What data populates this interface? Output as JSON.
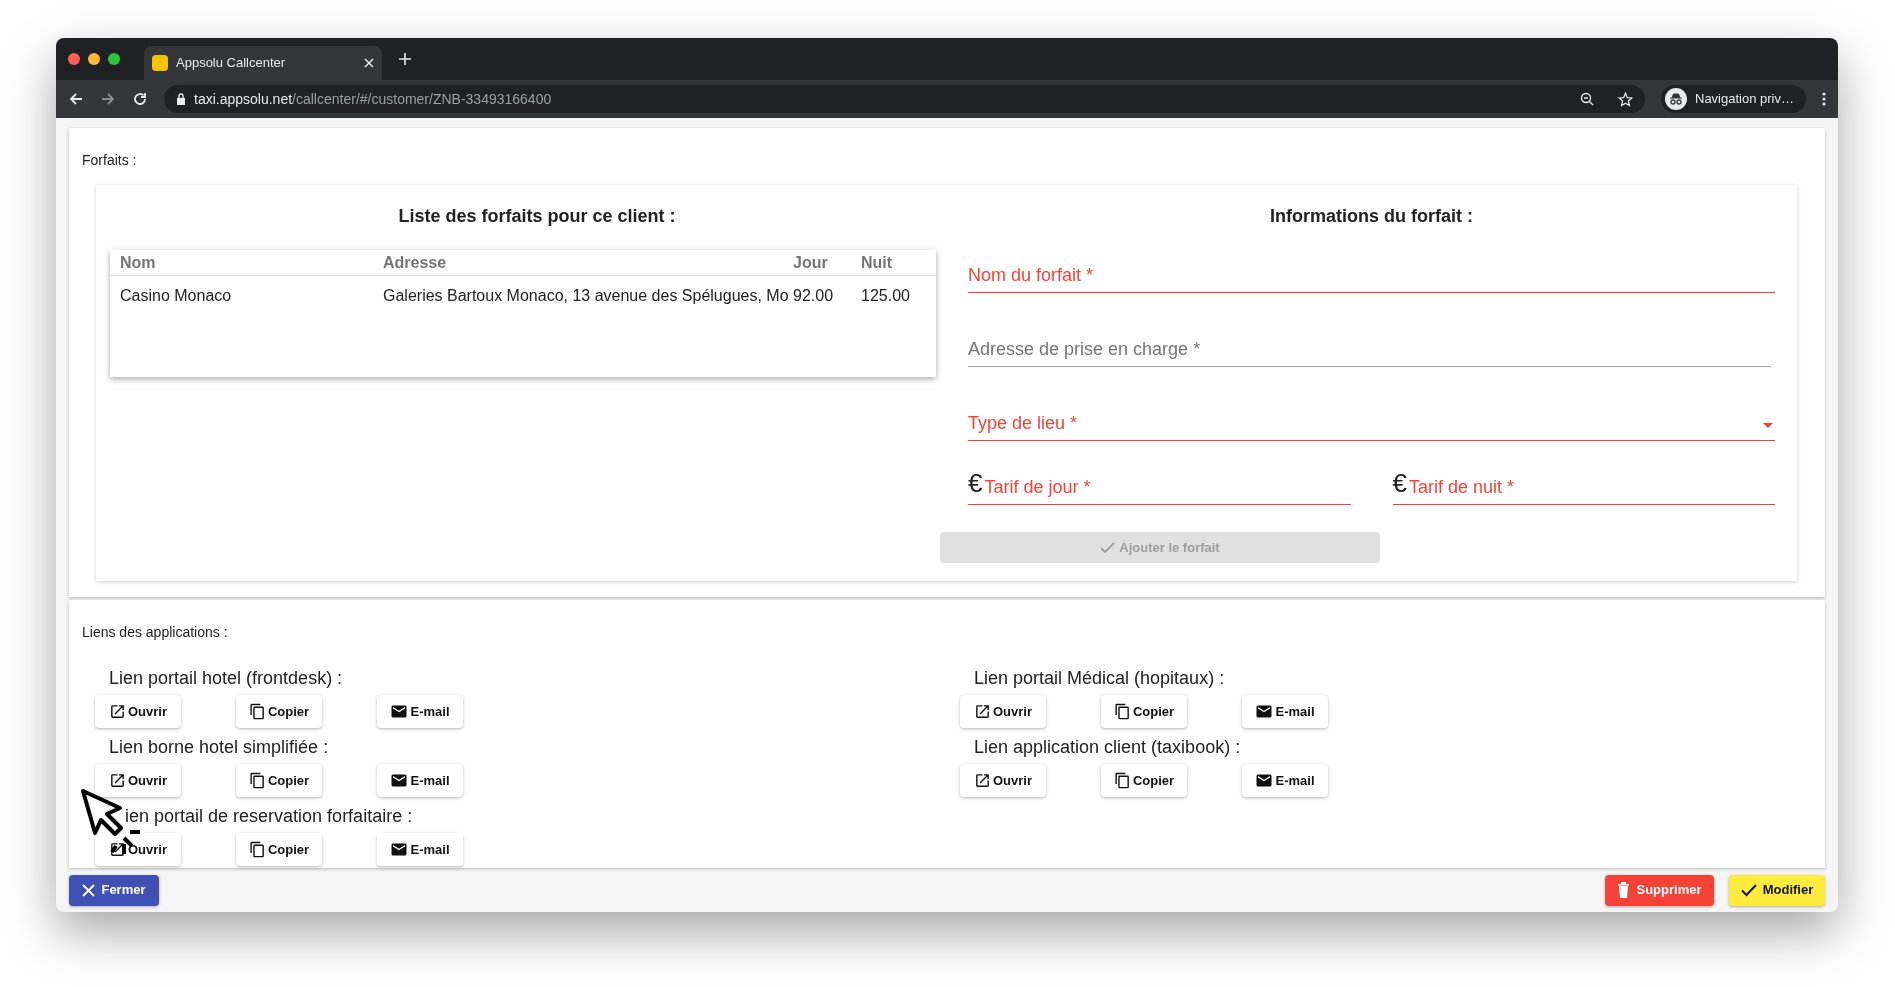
{
  "browser": {
    "tab_title": "Appsolu Callcenter",
    "url_host": "taxi.appsolu.net",
    "url_path": "/callcenter/#/customer/ZNB-33493166400",
    "profile_label": "Navigation priv…"
  },
  "forfaits": {
    "label": "Forfaits :",
    "list_title": "Liste des forfaits pour ce client :",
    "columns": [
      "Nom",
      "Adresse",
      "Jour",
      "Nuit"
    ],
    "rows": [
      {
        "cells": [
          "Casino Monaco",
          "Galeries Bartoux Monaco, 13 avenue des Spélugues, Mo",
          "92.00",
          "125.00"
        ]
      }
    ],
    "form_title": "Informations du forfait :",
    "fields": [
      {
        "kind": "text",
        "label": "Nom du forfait *",
        "error": true
      },
      {
        "kind": "text",
        "label": "Adresse de prise en charge *",
        "error": false
      },
      {
        "kind": "select",
        "label": "Type de lieu *",
        "error": true
      },
      {
        "kind": "currency",
        "symbol": "€",
        "label": "Tarif de jour *",
        "error": true
      },
      {
        "kind": "currency",
        "symbol": "€",
        "label": "Tarif de nuit *",
        "error": true
      }
    ],
    "add_button": {
      "label": "Ajouter le forfait",
      "disabled": true
    }
  },
  "links": {
    "label": "Liens des applications :",
    "columns": [
      [
        {
          "title": "Lien portail hotel (frontdesk) :",
          "buttons": [
            {
              "kind": "open",
              "label": "Ouvrir"
            },
            {
              "kind": "copy",
              "label": "Copier"
            },
            {
              "kind": "email",
              "label": "E-mail"
            }
          ]
        },
        {
          "title": "Lien borne hotel simplifiée :",
          "buttons": [
            {
              "kind": "open",
              "label": "Ouvrir"
            },
            {
              "kind": "copy",
              "label": "Copier"
            },
            {
              "kind": "email",
              "label": "E-mail"
            }
          ]
        },
        {
          "title": "ien portail de reservation forfaitaire :",
          "buttons": [
            {
              "kind": "open",
              "label": "Ouvrir"
            },
            {
              "kind": "copy",
              "label": "Copier"
            },
            {
              "kind": "email",
              "label": "E-mail"
            }
          ]
        }
      ],
      [
        {
          "title": "Lien portail Médical (hopitaux) :",
          "buttons": [
            {
              "kind": "open",
              "label": "Ouvrir"
            },
            {
              "kind": "copy",
              "label": "Copier"
            },
            {
              "kind": "email",
              "label": "E-mail"
            }
          ]
        },
        {
          "title": "Lien application client (taxibook) :",
          "buttons": [
            {
              "kind": "open",
              "label": "Ouvrir"
            },
            {
              "kind": "copy",
              "label": "Copier"
            },
            {
              "kind": "email",
              "label": "E-mail"
            }
          ]
        }
      ]
    ]
  },
  "footer": {
    "close": {
      "kind": "close",
      "label": "Fermer"
    },
    "actions": [
      {
        "kind": "delete",
        "label": "Supprimer"
      },
      {
        "kind": "confirm",
        "label": "Modifier"
      }
    ]
  }
}
